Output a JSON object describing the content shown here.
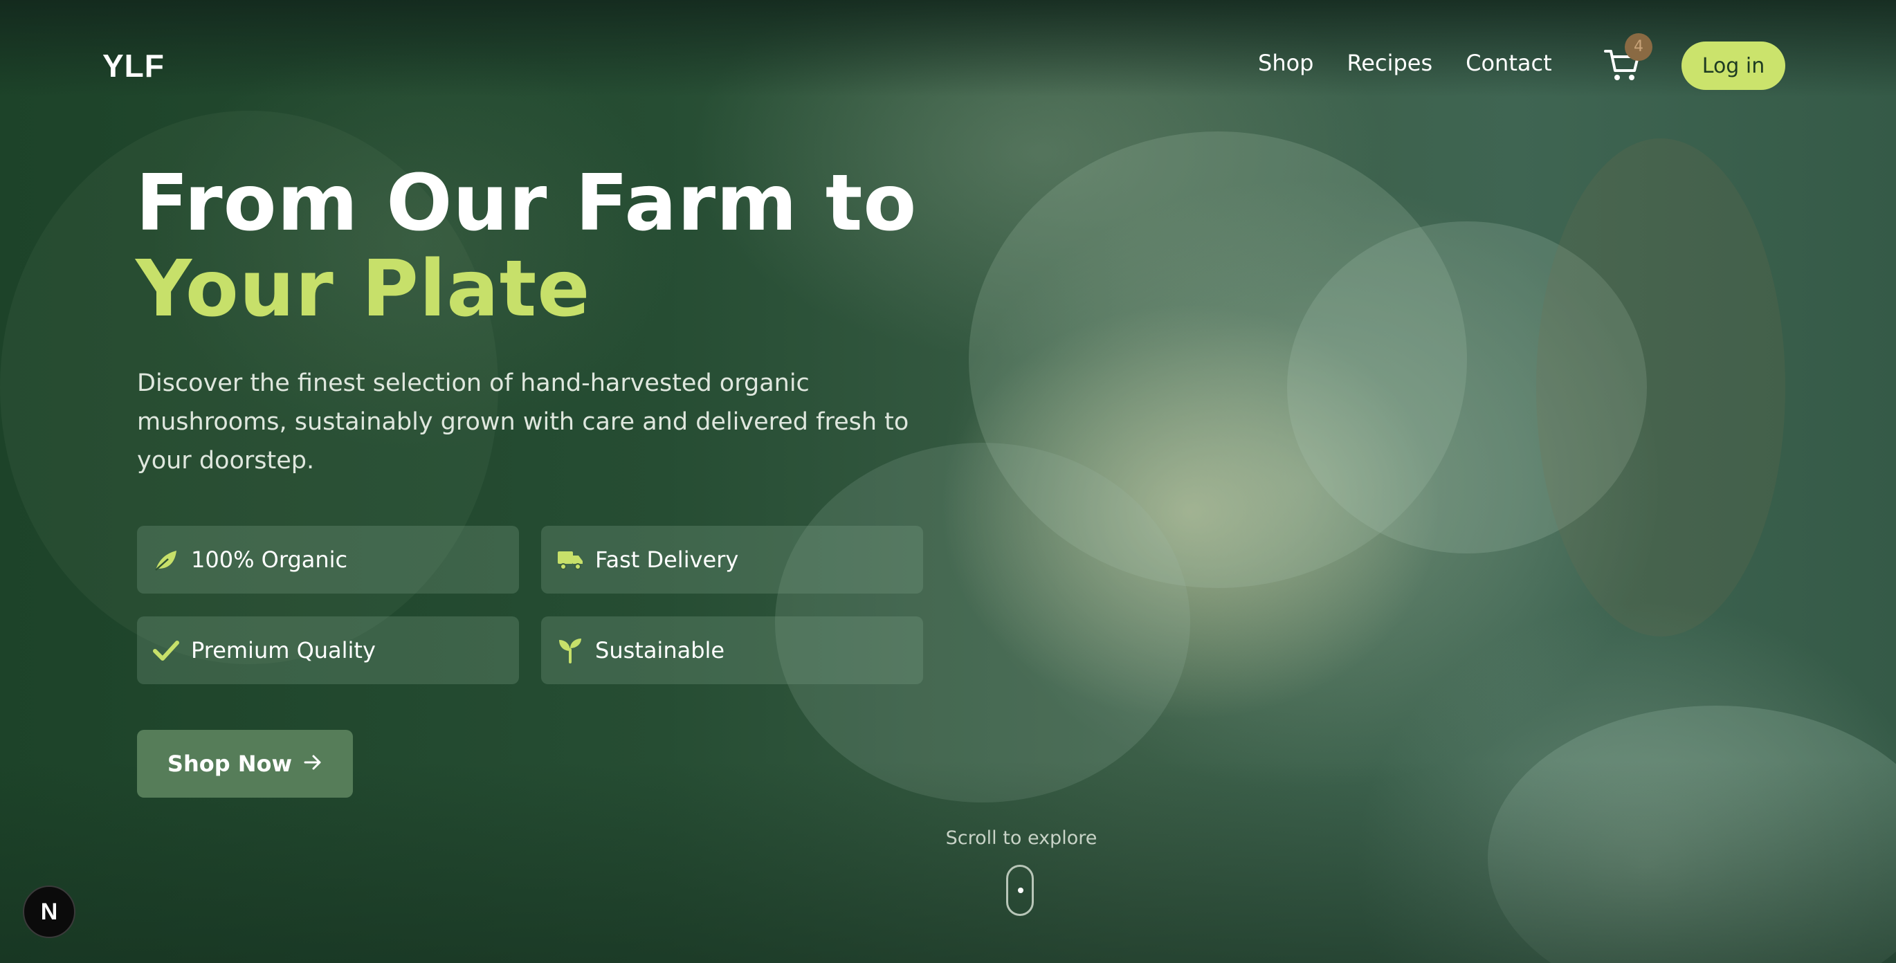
{
  "header": {
    "logo": "YLF",
    "nav": [
      "Shop",
      "Recipes",
      "Contact"
    ],
    "cart_count": "4",
    "login_label": "Log in"
  },
  "hero": {
    "title_line1": "From Our Farm to",
    "title_line2": "Your Plate",
    "description": "Discover the finest selection of hand-harvested organic mushrooms, sustainably grown with care and delivered fresh to your doorstep.",
    "features": [
      {
        "label": "100% Organic",
        "icon": "leaf-icon"
      },
      {
        "label": "Fast Delivery",
        "icon": "truck-icon"
      },
      {
        "label": "Premium Quality",
        "icon": "check-icon"
      },
      {
        "label": "Sustainable",
        "icon": "seedling-icon"
      }
    ],
    "cta_label": "Shop Now"
  },
  "scroll": {
    "label": "Scroll to explore"
  },
  "dev_badge": "N",
  "colors": {
    "accent": "#cbe36c",
    "title_highlight": "#c7e06a",
    "cta_bg": "#567d59",
    "cart_badge": "#8a6a43"
  }
}
